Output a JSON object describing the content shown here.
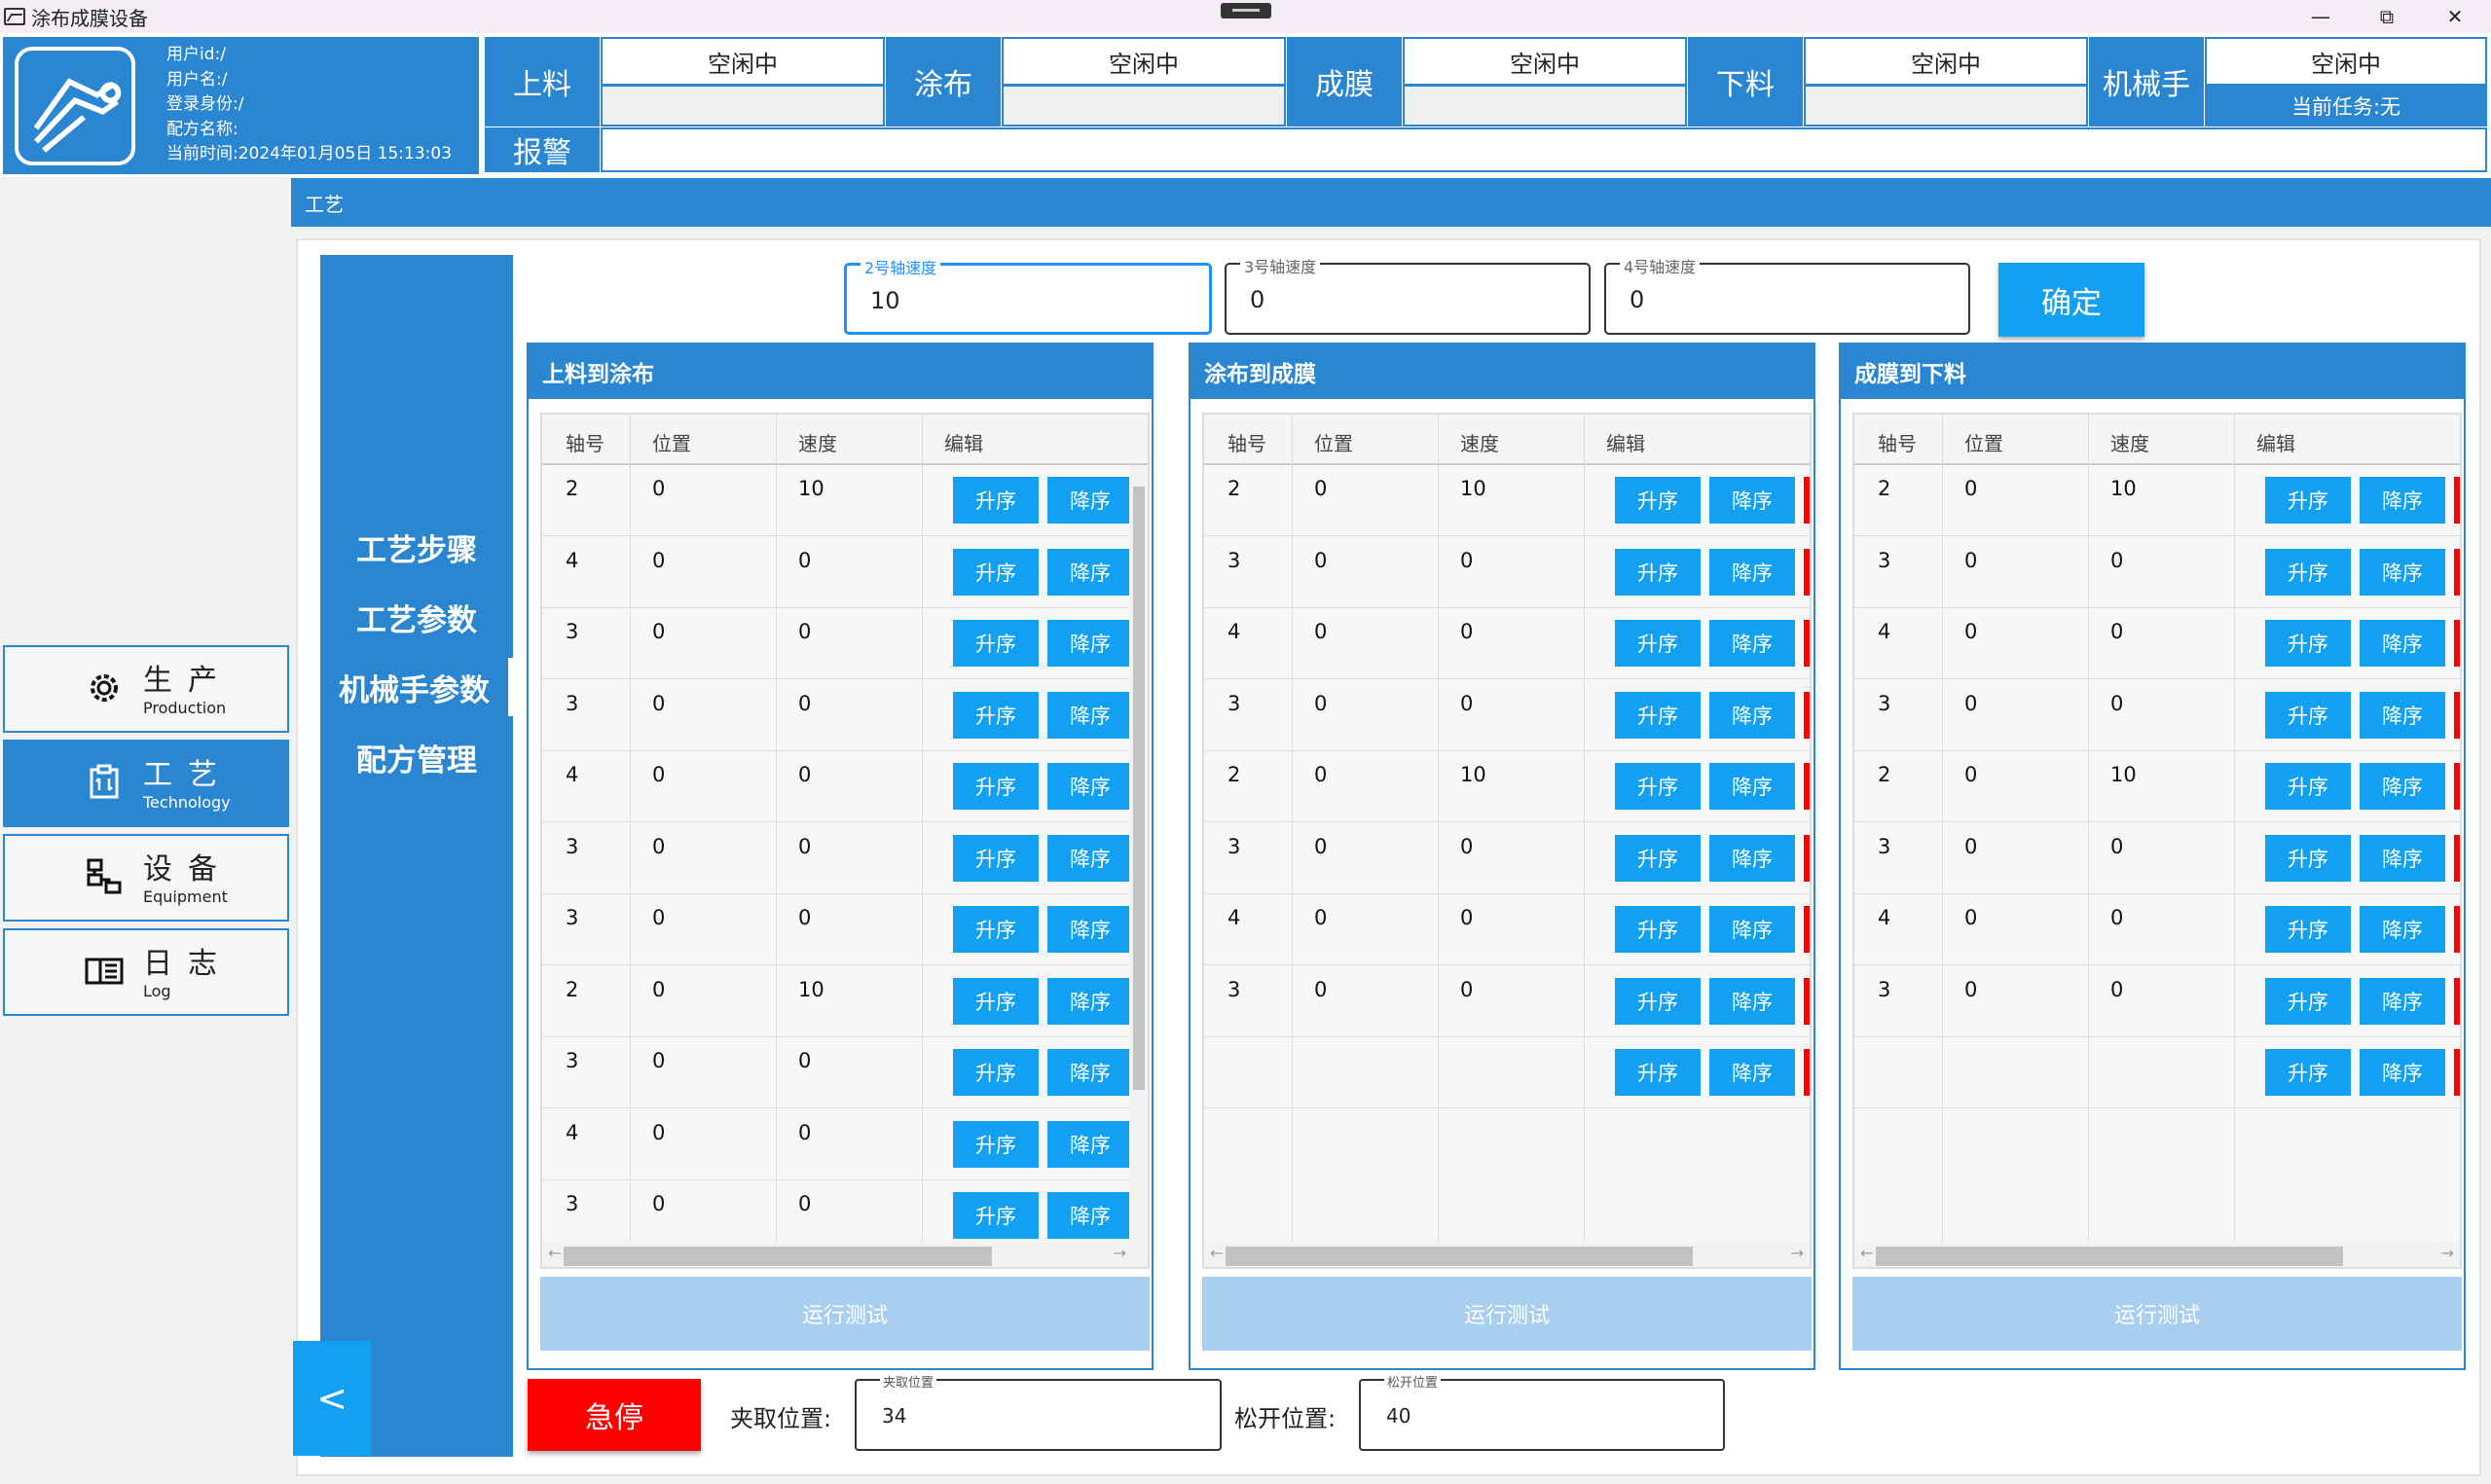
{
  "window": {
    "title": "涂布成膜设备"
  },
  "user": {
    "id_label": "用户id:/",
    "name_label": "用户名:/",
    "role_label": "登录身份:/",
    "recipe_label": "配方名称:",
    "time_label": "当前时间:2024年01月05日 15:13:03"
  },
  "stations": [
    {
      "label": "上料",
      "status": "空闲中"
    },
    {
      "label": "涂布",
      "status": "空闲中"
    },
    {
      "label": "成膜",
      "status": "空闲中"
    },
    {
      "label": "下料",
      "status": "空闲中"
    },
    {
      "label": "机械手",
      "status": "空闲中",
      "sub": "当前任务:无"
    }
  ],
  "alarm": {
    "label": "报警",
    "text": ""
  },
  "nav": [
    {
      "zh": "生产",
      "en": "Production",
      "icon": "gear-icon"
    },
    {
      "zh": "工艺",
      "en": "Technology",
      "icon": "clipboard-icon"
    },
    {
      "zh": "设备",
      "en": "Equipment",
      "icon": "network-icon"
    },
    {
      "zh": "日志",
      "en": "Log",
      "icon": "book-icon"
    }
  ],
  "content": {
    "header": "工艺"
  },
  "tabs": [
    "工艺步骤",
    "工艺参数",
    "机械手参数",
    "配方管理"
  ],
  "selected_tab": "机械手参数",
  "speed_fields": [
    {
      "label": "2号轴速度",
      "value": "10"
    },
    {
      "label": "3号轴速度",
      "value": "0"
    },
    {
      "label": "4号轴速度",
      "value": "0"
    }
  ],
  "confirm_label": "确定",
  "table_columns": [
    "轴号",
    "位置",
    "速度",
    "编辑"
  ],
  "buttons": {
    "up": "升序",
    "down": "降序",
    "run": "运行测试"
  },
  "panels": [
    {
      "title": "上料到涂布",
      "rows": [
        [
          "2",
          "0",
          "10"
        ],
        [
          "4",
          "0",
          "0"
        ],
        [
          "3",
          "0",
          "0"
        ],
        [
          "3",
          "0",
          "0"
        ],
        [
          "4",
          "0",
          "0"
        ],
        [
          "3",
          "0",
          "0"
        ],
        [
          "3",
          "0",
          "0"
        ],
        [
          "2",
          "0",
          "10"
        ],
        [
          "3",
          "0",
          "0"
        ],
        [
          "4",
          "0",
          "0"
        ],
        [
          "3",
          "0",
          "0"
        ]
      ]
    },
    {
      "title": "涂布到成膜",
      "rows": [
        [
          "2",
          "0",
          "10"
        ],
        [
          "3",
          "0",
          "0"
        ],
        [
          "4",
          "0",
          "0"
        ],
        [
          "3",
          "0",
          "0"
        ],
        [
          "2",
          "0",
          "10"
        ],
        [
          "3",
          "0",
          "0"
        ],
        [
          "4",
          "0",
          "0"
        ],
        [
          "3",
          "0",
          "0"
        ],
        [
          "",
          "",
          ""
        ]
      ]
    },
    {
      "title": "成膜到下料",
      "rows": [
        [
          "2",
          "0",
          "10"
        ],
        [
          "3",
          "0",
          "0"
        ],
        [
          "4",
          "0",
          "0"
        ],
        [
          "3",
          "0",
          "0"
        ],
        [
          "2",
          "0",
          "10"
        ],
        [
          "3",
          "0",
          "0"
        ],
        [
          "4",
          "0",
          "0"
        ],
        [
          "3",
          "0",
          "0"
        ],
        [
          "",
          "",
          ""
        ]
      ]
    }
  ],
  "bottom": {
    "estop": "急停",
    "grip_label": "夹取位置:",
    "grip_field_label": "夹取位置",
    "grip_value": "34",
    "release_label": "松开位置:",
    "release_field_label": "松开位置",
    "release_value": "40"
  },
  "back_label": "<",
  "accent_color": "#2b86d1",
  "button_color": "#12a0f3",
  "estop_color": "#ff0000"
}
